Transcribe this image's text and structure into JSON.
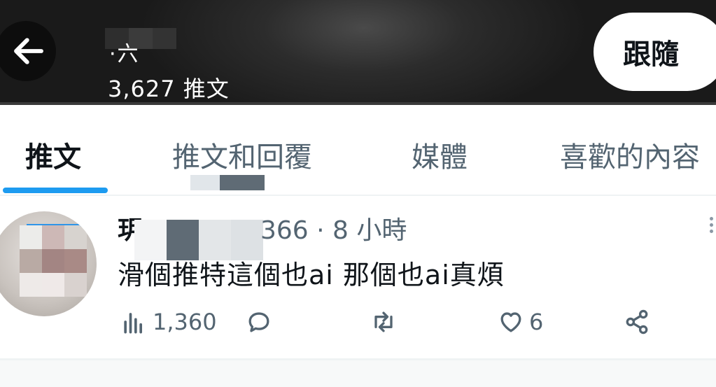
{
  "header": {
    "name_visible": "·六",
    "tweet_count": "3,627 推文",
    "follow_label": "跟隨"
  },
  "tabs": [
    {
      "label": "推文",
      "active": true
    },
    {
      "label": "推文和回覆",
      "active": false
    },
    {
      "label": "媒體",
      "active": false
    },
    {
      "label": "喜歡的內容",
      "active": false
    }
  ],
  "tweet": {
    "author_initial": "玥",
    "handle_suffix": "366 · 8 小時",
    "text": "滑個推特這個也ai 那個也ai真煩",
    "views": "1,360",
    "likes": "6"
  },
  "colors": {
    "accent": "#1d9bf0",
    "text_primary": "#0f1419",
    "text_secondary": "#536471",
    "header_bg": "#1c1c1c"
  },
  "icons": {
    "back": "arrow-left-icon",
    "more": "more-vertical-icon",
    "views": "bar-chart-icon",
    "reply": "speech-bubble-icon",
    "retweet": "retweet-icon",
    "like": "heart-icon",
    "share": "share-icon"
  }
}
